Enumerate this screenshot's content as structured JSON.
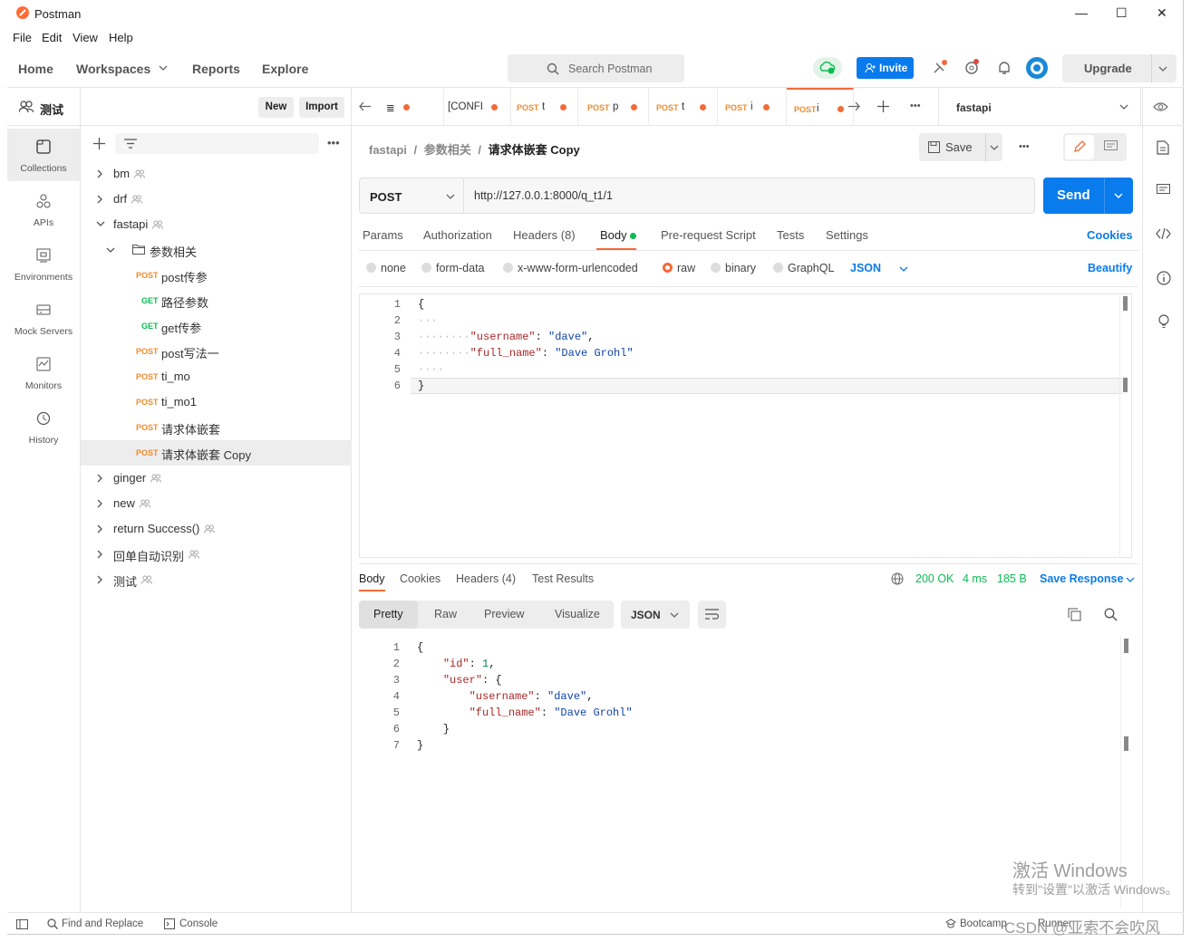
{
  "window": {
    "title": "Postman",
    "minimize": "—",
    "maximize": "☐",
    "close": "✕"
  },
  "menu": [
    "File",
    "Edit",
    "View",
    "Help"
  ],
  "header": {
    "nav": [
      "Home",
      "Workspaces",
      "Reports",
      "Explore"
    ],
    "search_placeholder": "Search Postman",
    "invite": "Invite",
    "upgrade": "Upgrade"
  },
  "workspace": {
    "name": "测试",
    "new": "New",
    "import": "Import"
  },
  "sidebar": [
    "Collections",
    "APIs",
    "Environments",
    "Mock Servers",
    "Monitors",
    "History"
  ],
  "tree": [
    {
      "label": "bm",
      "level": 0
    },
    {
      "label": "drf",
      "level": 0
    },
    {
      "label": "fastapi",
      "level": 0,
      "open": true
    },
    {
      "label": "参数相关",
      "level": 1,
      "folder": true
    },
    {
      "method": "POST",
      "label": "post传参",
      "level": 2
    },
    {
      "method": "GET",
      "label": "路径参数",
      "level": 2
    },
    {
      "method": "GET",
      "label": "get传参",
      "level": 2
    },
    {
      "method": "POST",
      "label": "post写法一",
      "level": 2
    },
    {
      "method": "POST",
      "label": "ti_mo",
      "level": 2
    },
    {
      "method": "POST",
      "label": "ti_mo1",
      "level": 2
    },
    {
      "method": "POST",
      "label": "请求体嵌套",
      "level": 2
    },
    {
      "method": "POST",
      "label": "请求体嵌套 Copy",
      "level": 2,
      "selected": true
    },
    {
      "label": "ginger",
      "level": 0
    },
    {
      "label": "new",
      "level": 0
    },
    {
      "label": "return Success()",
      "level": 0
    },
    {
      "label": "回单自动识别",
      "level": 0
    },
    {
      "label": "测试",
      "level": 0
    }
  ],
  "tabs": [
    {
      "method": "",
      "label": "≣"
    },
    {
      "method": "",
      "label": "[CONFI"
    },
    {
      "method": "POST",
      "label": "t"
    },
    {
      "method": "POST",
      "label": "p"
    },
    {
      "method": "POST",
      "label": "t"
    },
    {
      "method": "POST",
      "label": "i"
    },
    {
      "method": "POST",
      "label": "i",
      "active": true
    }
  ],
  "environment": "fastapi",
  "breadcrumb": {
    "collection": "fastapi",
    "folder": "参数相关",
    "request": "请求体嵌套 Copy",
    "sep": "/"
  },
  "save": "Save",
  "request": {
    "method": "POST",
    "url": "http://127.0.0.1:8000/q_t1/1",
    "send": "Send"
  },
  "req_tabs": [
    "Params",
    "Authorization",
    "Headers (8)",
    "Body",
    "Pre-request Script",
    "Tests",
    "Settings"
  ],
  "cookies": "Cookies",
  "body_types": [
    "none",
    "form-data",
    "x-www-form-urlencoded",
    "raw",
    "binary",
    "GraphQL"
  ],
  "body_format": "JSON",
  "beautify": "Beautify",
  "request_body": [
    [
      {
        "t": "p",
        "v": "{"
      }
    ],
    [
      {
        "t": "d",
        "v": "···"
      }
    ],
    [
      {
        "t": "d",
        "v": "········"
      },
      {
        "t": "k",
        "v": "\"username\""
      },
      {
        "t": "p",
        "v": ": "
      },
      {
        "t": "s",
        "v": "\"dave\""
      },
      {
        "t": "p",
        "v": ","
      }
    ],
    [
      {
        "t": "d",
        "v": "········"
      },
      {
        "t": "k",
        "v": "\"full_name\""
      },
      {
        "t": "p",
        "v": ": "
      },
      {
        "t": "s",
        "v": "\"Dave Grohl\""
      }
    ],
    [
      {
        "t": "d",
        "v": "····"
      }
    ],
    [
      {
        "t": "p",
        "v": "}"
      }
    ]
  ],
  "resp_tabs": [
    "Body",
    "Cookies",
    "Headers (4)",
    "Test Results"
  ],
  "response": {
    "status": "200 OK",
    "time": "4 ms",
    "size": "185 B",
    "save": "Save Response"
  },
  "resp_views": [
    "Pretty",
    "Raw",
    "Preview",
    "Visualize"
  ],
  "resp_format": "JSON",
  "response_body": [
    [
      {
        "t": "p",
        "v": "{"
      }
    ],
    [
      {
        "t": "p",
        "v": "    "
      },
      {
        "t": "k",
        "v": "\"id\""
      },
      {
        "t": "p",
        "v": ": "
      },
      {
        "t": "n",
        "v": "1"
      },
      {
        "t": "p",
        "v": ","
      }
    ],
    [
      {
        "t": "p",
        "v": "    "
      },
      {
        "t": "k",
        "v": "\"user\""
      },
      {
        "t": "p",
        "v": ": {"
      }
    ],
    [
      {
        "t": "p",
        "v": "        "
      },
      {
        "t": "k",
        "v": "\"username\""
      },
      {
        "t": "p",
        "v": ": "
      },
      {
        "t": "s",
        "v": "\"dave\""
      },
      {
        "t": "p",
        "v": ","
      }
    ],
    [
      {
        "t": "p",
        "v": "        "
      },
      {
        "t": "k",
        "v": "\"full_name\""
      },
      {
        "t": "p",
        "v": ": "
      },
      {
        "t": "s",
        "v": "\"Dave Grohl\""
      }
    ],
    [
      {
        "t": "p",
        "v": "    }"
      }
    ],
    [
      {
        "t": "p",
        "v": "}"
      }
    ]
  ],
  "statusbar": {
    "find": "Find and Replace",
    "console": "Console",
    "bootcamp": "Bootcamp",
    "runner": "Runner"
  },
  "watermark": {
    "line1": "激活 Windows",
    "line2": "转到\"设置\"以激活 Windows。",
    "csdn": "CSDN @亚索不会吹风"
  }
}
